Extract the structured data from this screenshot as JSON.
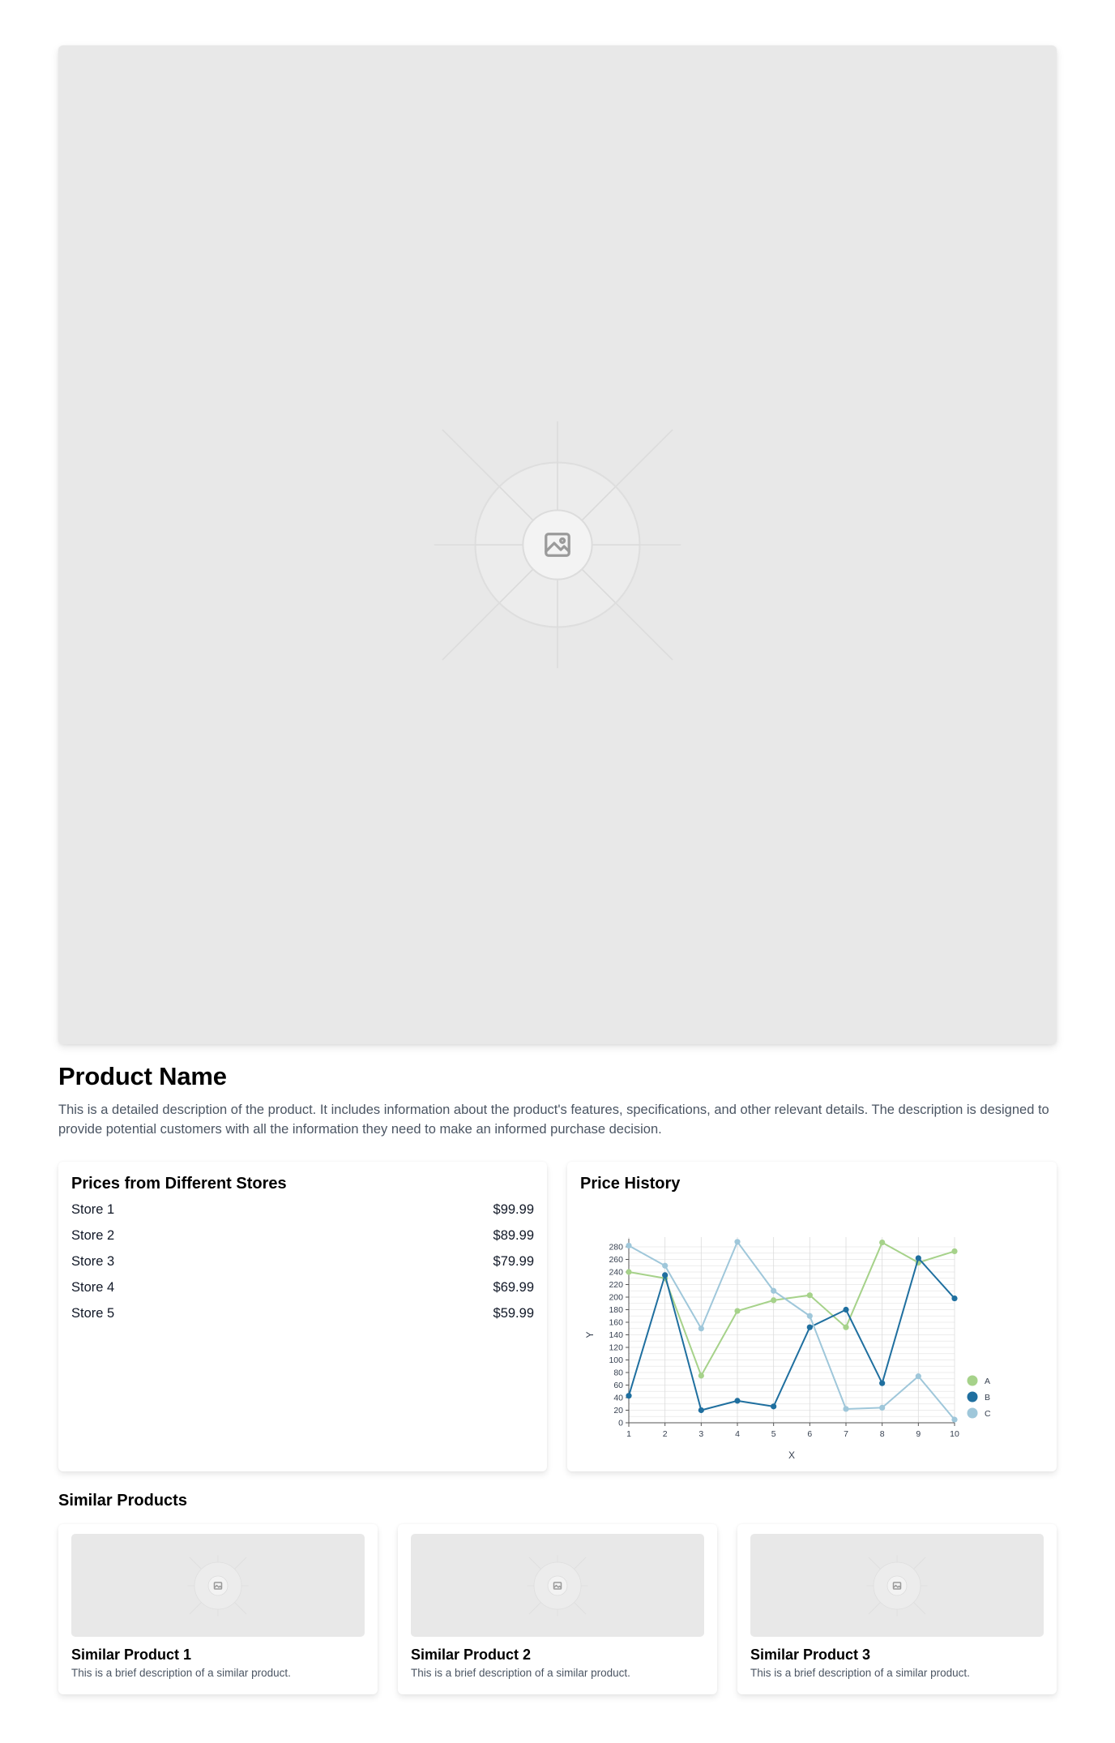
{
  "product": {
    "image_icon": "image-placeholder-icon",
    "name": "Product Name",
    "description": "This is a detailed description of the product. It includes information about the product's features, specifications, and other relevant details. The description is designed to provide potential customers with all the information they need to make an informed purchase decision."
  },
  "prices": {
    "title": "Prices from Different Stores",
    "stores": [
      {
        "store": "Store 1",
        "price": "$99.99"
      },
      {
        "store": "Store 2",
        "price": "$89.99"
      },
      {
        "store": "Store 3",
        "price": "$79.99"
      },
      {
        "store": "Store 4",
        "price": "$69.99"
      },
      {
        "store": "Store 5",
        "price": "$59.99"
      }
    ]
  },
  "history": {
    "title": "Price History"
  },
  "chart_data": {
    "type": "line",
    "x": [
      1,
      2,
      3,
      4,
      5,
      6,
      7,
      8,
      9,
      10
    ],
    "xlabel": "X",
    "ylabel": "Y",
    "xlim": [
      1,
      10
    ],
    "ylim": [
      0,
      280
    ],
    "yticks": [
      0,
      20,
      40,
      60,
      80,
      100,
      120,
      140,
      160,
      180,
      200,
      220,
      240,
      260,
      280
    ],
    "grid": true,
    "legend_position": "bottom-right",
    "series": [
      {
        "name": "A",
        "color": "#a6d28a",
        "values": [
          240,
          230,
          75,
          178,
          195,
          203,
          152,
          287,
          255,
          273
        ]
      },
      {
        "name": "B",
        "color": "#1f6f9f",
        "values": [
          43,
          235,
          20,
          35,
          26,
          152,
          180,
          63,
          262,
          198
        ]
      },
      {
        "name": "C",
        "color": "#9fc7da",
        "values": [
          282,
          250,
          150,
          288,
          210,
          170,
          22,
          24,
          74,
          5
        ]
      }
    ]
  },
  "similar": {
    "title": "Similar Products",
    "items": [
      {
        "name": "Similar Product 1",
        "description": "This is a brief description of a similar product."
      },
      {
        "name": "Similar Product 2",
        "description": "This is a brief description of a similar product."
      },
      {
        "name": "Similar Product 3",
        "description": "This is a brief description of a similar product."
      }
    ]
  }
}
